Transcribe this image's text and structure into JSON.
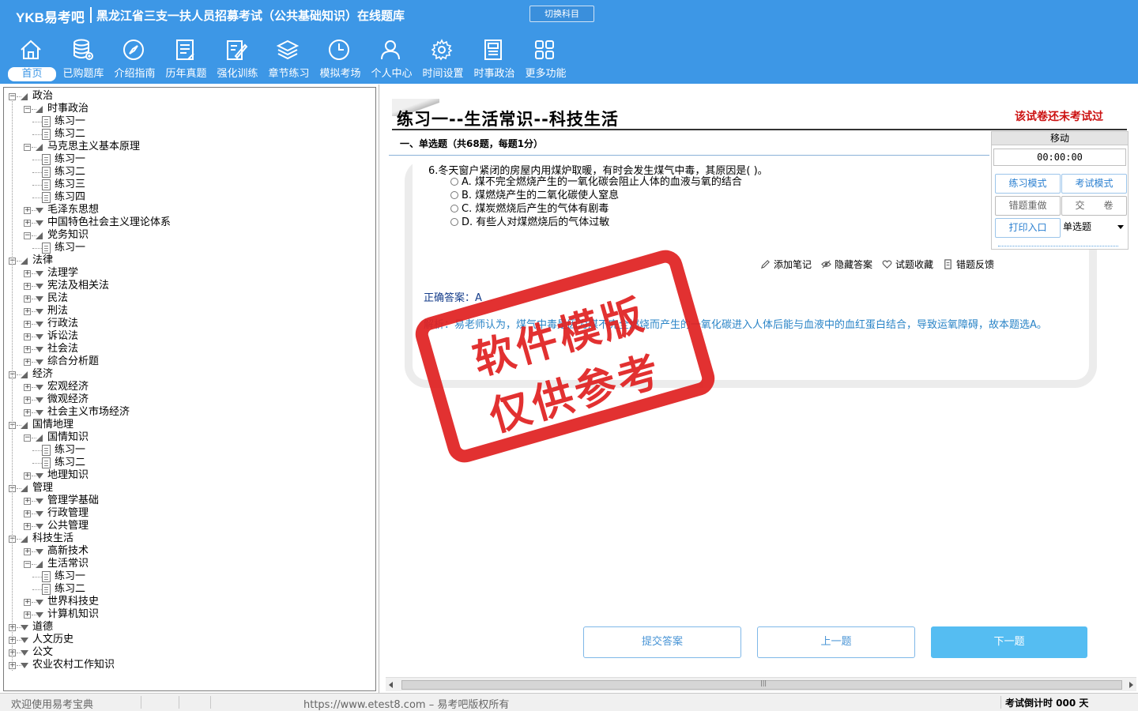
{
  "header": {
    "logo": "YKB易考吧",
    "title": "黑龙江省三支一扶人员招募考试（公共基础知识）在线题库",
    "switch_label": "切换科目",
    "nav": [
      {
        "label": "首页",
        "icon": "home-icon"
      },
      {
        "label": "已购题库",
        "icon": "database-icon"
      },
      {
        "label": "介绍指南",
        "icon": "compass-icon"
      },
      {
        "label": "历年真题",
        "icon": "document-list-icon"
      },
      {
        "label": "强化训练",
        "icon": "edit-icon"
      },
      {
        "label": "章节练习",
        "icon": "layers-icon"
      },
      {
        "label": "模拟考场",
        "icon": "clock-icon"
      },
      {
        "label": "个人中心",
        "icon": "user-icon"
      },
      {
        "label": "时间设置",
        "icon": "gear-icon"
      },
      {
        "label": "时事政治",
        "icon": "newspaper-icon"
      },
      {
        "label": "更多功能",
        "icon": "grid-icon"
      }
    ]
  },
  "tree": [
    {
      "label": "政治",
      "level": 0,
      "type": "folder",
      "open": true
    },
    {
      "label": "时事政治",
      "level": 1,
      "type": "folder",
      "open": true
    },
    {
      "label": "练习一",
      "level": 2,
      "type": "doc"
    },
    {
      "label": "练习二",
      "level": 2,
      "type": "doc"
    },
    {
      "label": "马克思主义基本原理",
      "level": 1,
      "type": "folder",
      "open": true
    },
    {
      "label": "练习一",
      "level": 2,
      "type": "doc"
    },
    {
      "label": "练习二",
      "level": 2,
      "type": "doc"
    },
    {
      "label": "练习三",
      "level": 2,
      "type": "doc"
    },
    {
      "label": "练习四",
      "level": 2,
      "type": "doc"
    },
    {
      "label": "毛泽东思想",
      "level": 1,
      "type": "folder",
      "open": false
    },
    {
      "label": "中国特色社会主义理论体系",
      "level": 1,
      "type": "folder",
      "open": false
    },
    {
      "label": "党务知识",
      "level": 1,
      "type": "folder",
      "open": true
    },
    {
      "label": "练习一",
      "level": 2,
      "type": "doc"
    },
    {
      "label": "法律",
      "level": 0,
      "type": "folder",
      "open": true
    },
    {
      "label": "法理学",
      "level": 1,
      "type": "folder",
      "open": false
    },
    {
      "label": "宪法及相关法",
      "level": 1,
      "type": "folder",
      "open": false
    },
    {
      "label": "民法",
      "level": 1,
      "type": "folder",
      "open": false
    },
    {
      "label": "刑法",
      "level": 1,
      "type": "folder",
      "open": false
    },
    {
      "label": "行政法",
      "level": 1,
      "type": "folder",
      "open": false
    },
    {
      "label": "诉讼法",
      "level": 1,
      "type": "folder",
      "open": false
    },
    {
      "label": "社会法",
      "level": 1,
      "type": "folder",
      "open": false
    },
    {
      "label": "综合分析题",
      "level": 1,
      "type": "folder",
      "open": false
    },
    {
      "label": "经济",
      "level": 0,
      "type": "folder",
      "open": true
    },
    {
      "label": "宏观经济",
      "level": 1,
      "type": "folder",
      "open": false
    },
    {
      "label": "微观经济",
      "level": 1,
      "type": "folder",
      "open": false
    },
    {
      "label": "社会主义市场经济",
      "level": 1,
      "type": "folder",
      "open": false
    },
    {
      "label": "国情地理",
      "level": 0,
      "type": "folder",
      "open": true
    },
    {
      "label": "国情知识",
      "level": 1,
      "type": "folder",
      "open": true
    },
    {
      "label": "练习一",
      "level": 2,
      "type": "doc"
    },
    {
      "label": "练习二",
      "level": 2,
      "type": "doc"
    },
    {
      "label": "地理知识",
      "level": 1,
      "type": "folder",
      "open": false
    },
    {
      "label": "管理",
      "level": 0,
      "type": "folder",
      "open": true
    },
    {
      "label": "管理学基础",
      "level": 1,
      "type": "folder",
      "open": false
    },
    {
      "label": "行政管理",
      "level": 1,
      "type": "folder",
      "open": false
    },
    {
      "label": "公共管理",
      "level": 1,
      "type": "folder",
      "open": false
    },
    {
      "label": "科技生活",
      "level": 0,
      "type": "folder",
      "open": true
    },
    {
      "label": "高新技术",
      "level": 1,
      "type": "folder",
      "open": false
    },
    {
      "label": "生活常识",
      "level": 1,
      "type": "folder",
      "open": true
    },
    {
      "label": "练习一",
      "level": 2,
      "type": "doc-current"
    },
    {
      "label": "练习二",
      "level": 2,
      "type": "doc"
    },
    {
      "label": "世界科技史",
      "level": 1,
      "type": "folder",
      "open": false
    },
    {
      "label": "计算机知识",
      "level": 1,
      "type": "folder",
      "open": false
    },
    {
      "label": "道德",
      "level": 0,
      "type": "folder",
      "open": false
    },
    {
      "label": "人文历史",
      "level": 0,
      "type": "folder",
      "open": false
    },
    {
      "label": "公文",
      "level": 0,
      "type": "folder",
      "open": false
    },
    {
      "label": "农业农村工作知识",
      "level": 0,
      "type": "folder",
      "open": false
    }
  ],
  "exercise": {
    "title": "练习一--生活常识--科技生活",
    "status": "该试卷还未考试过",
    "section": "一、单选题（共68题，每题1分）",
    "question": "6.冬天窗户紧闭的房屋内用煤炉取暖，有时会发生煤气中毒，其原因是( )。",
    "options": [
      "A. 煤不完全燃烧产生的一氧化碳会阻止人体的血液与氧的结合",
      "B. 煤燃烧产生的二氧化碳使人窒息",
      "C. 煤炭燃烧后产生的气体有剧毒",
      "D. 有些人对煤燃烧后的气体过敏"
    ],
    "tools": [
      "添加笔记",
      "隐藏答案",
      "试题收藏",
      "错题反馈"
    ],
    "answer": "正确答案：A",
    "analysis": "解析：易老师认为，煤气中毒是因为煤不完全燃烧而产生的一氧化碳进入人体后能与血液中的血红蛋白结合，导致运氧障碍，故本题选A。"
  },
  "panel": {
    "move_label": "移动",
    "timer": "00:00:00",
    "practice_mode": "练习模式",
    "exam_mode": "考试模式",
    "redo_wrong": "错题重做",
    "submit_paper": "交　　卷",
    "print_entry": "打印入口",
    "question_type": "单选题"
  },
  "buttons": {
    "submit": "提交答案",
    "prev": "上一题",
    "next": "下一题"
  },
  "status": {
    "welcome": "欢迎使用易考宝典",
    "copyright": "https://www.etest8.com – 易考吧版权所有",
    "countdown": "考试倒计时 000 天"
  },
  "watermark": {
    "line1": "软件模版",
    "line2": "仅供参考"
  }
}
